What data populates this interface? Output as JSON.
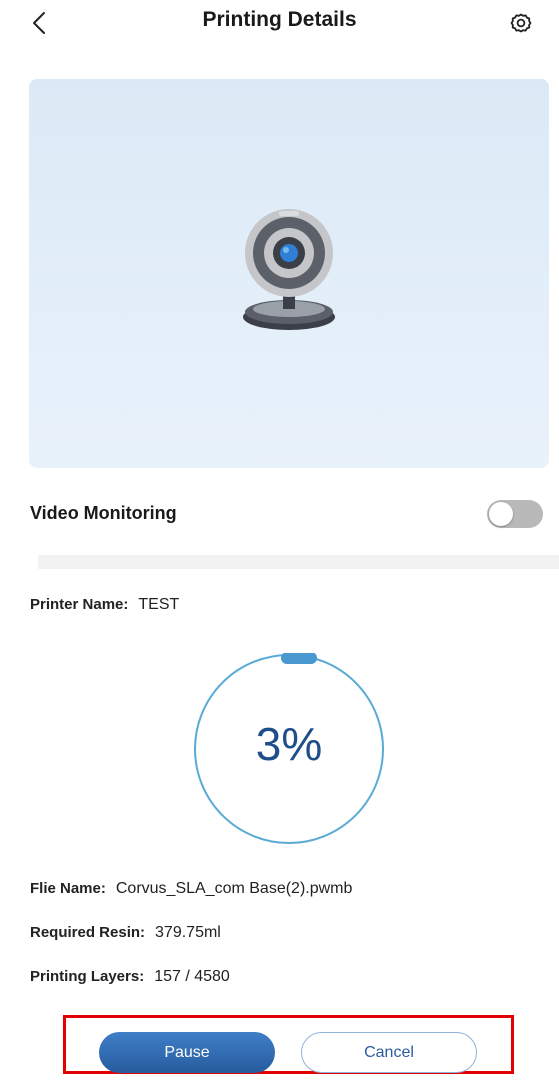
{
  "header": {
    "title": "Printing Details",
    "back_icon": "chevron-left-icon",
    "settings_icon": "gear-icon"
  },
  "camera": {
    "icon": "webcam-icon",
    "video_monitoring_label": "Video Monitoring",
    "video_monitoring_enabled": false
  },
  "printer": {
    "name_label": "Printer Name:",
    "name_value": "TEST"
  },
  "progress": {
    "percent": 3,
    "text": "3%",
    "ring_color": "#5aaad6",
    "text_color": "#1f4f8a"
  },
  "details": {
    "file_label": "Flie Name:",
    "file_value": "Corvus_SLA_com Base(2).pwmb",
    "resin_label": "Required Resin:",
    "resin_value": "379.75ml",
    "layers_label": "Printing Layers:",
    "layers_value": "157 / 4580"
  },
  "actions": {
    "pause_label": "Pause",
    "cancel_label": "Cancel"
  }
}
